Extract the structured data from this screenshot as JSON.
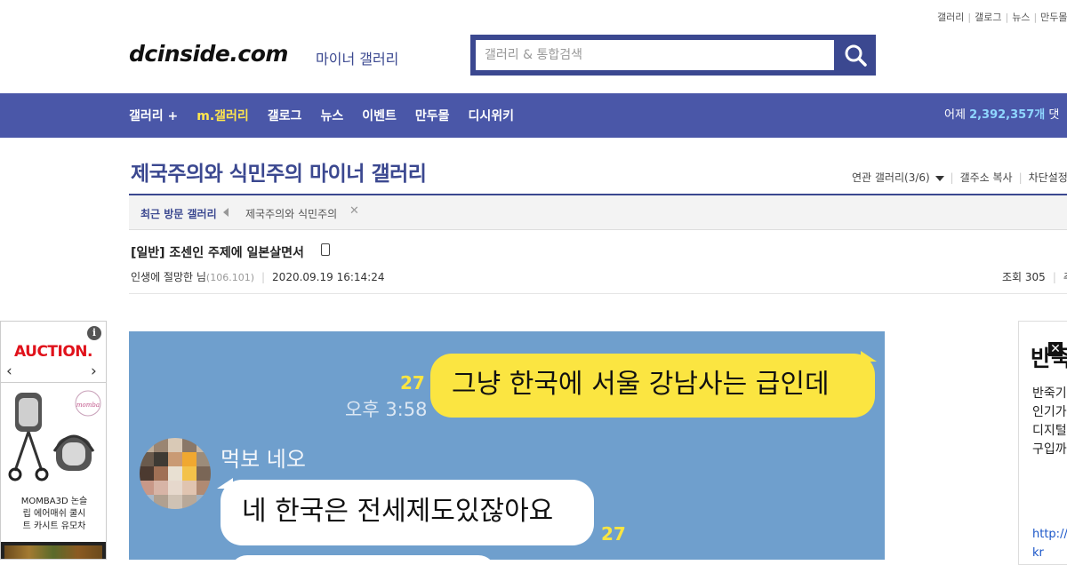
{
  "top_links": [
    "갤러리",
    "갤로그",
    "뉴스",
    "만두몰"
  ],
  "logo": {
    "text": "dcinside.com",
    "subtitle": "마이너 갤러리"
  },
  "search": {
    "placeholder": "갤러리 & 통합검색",
    "button_icon": "search-icon"
  },
  "nav": {
    "items": [
      {
        "label": "갤러리 +",
        "highlight": false
      },
      {
        "label": "m.갤러리",
        "highlight": true
      },
      {
        "label": "갤로그",
        "highlight": false
      },
      {
        "label": "뉴스",
        "highlight": false
      },
      {
        "label": "이벤트",
        "highlight": false
      },
      {
        "label": "만두몰",
        "highlight": false
      },
      {
        "label": "디시위키",
        "highlight": false
      }
    ],
    "stats_label": "어제",
    "stats_value": "2,392,357개",
    "stats_suffix": "댓"
  },
  "gallery": {
    "title": "제국주의와 식민주의 마이너 갤러리",
    "related": "연관 갤러리(3/6)",
    "copy_address": "갤주소 복사",
    "block_settings": "차단설정"
  },
  "recent": {
    "label": "최근 방문 갤러리",
    "items": [
      "제국주의와 식민주의"
    ]
  },
  "post": {
    "title": "[일반] 조센인 주제에 일본살면서",
    "author": "인생에 절망한 님",
    "ip": "(106.101)",
    "datetime": "2020.09.19 16:14:24",
    "views_label": "조회 305",
    "views_tail": "추"
  },
  "ad_left": {
    "brand": "AUCTION.",
    "caption_lines": [
      "MOMBA3D 논슬",
      "립 에어매쉬 쿨시",
      "트 카시트 유모차"
    ],
    "info_icon": "info-icon"
  },
  "chat": {
    "message1": "그냥 한국에 서울 강남사는 급인데",
    "unread1": "27",
    "time1": "오후 3:58",
    "sender": "먹보 네오",
    "message2": "네 한국은 전세제도있잖아요",
    "unread2": "27"
  },
  "ad_right": {
    "title": "반죽",
    "text_lines": [
      "반죽기",
      "인기가",
      "디지털",
      "구입까"
    ],
    "url_lines": [
      "http://w",
      "kr"
    ]
  },
  "colors": {
    "brand_blue": "#3b4890",
    "nav_bar": "#4a57a8",
    "highlight_yellow": "#ffe64d",
    "chat_bg": "#6f9fcd",
    "bubble_yellow": "#fbe541",
    "auction_red": "#e0121b"
  }
}
